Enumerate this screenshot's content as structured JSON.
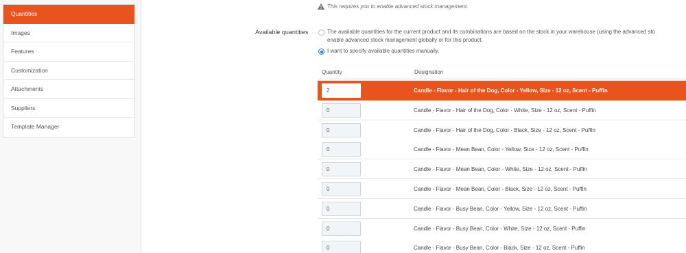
{
  "sidebar": {
    "items": [
      {
        "label": "Quantities",
        "active": true
      },
      {
        "label": "Images",
        "active": false
      },
      {
        "label": "Features",
        "active": false
      },
      {
        "label": "Customization",
        "active": false
      },
      {
        "label": "Attachments",
        "active": false
      },
      {
        "label": "Suppliers",
        "active": false
      },
      {
        "label": "Template Manager",
        "active": false
      }
    ]
  },
  "notice": {
    "icon": "warning-icon",
    "text": "This requires you to enable advanced stock management."
  },
  "available_quantities": {
    "label": "Available quantities",
    "option_1_line1": "The available quantities for the current product and its combinations are based on the stock in your warehouse (using the advanced sto",
    "option_1_line2": "enable advanced stock management globally or for this product.",
    "option_2": "I want to specify available quantities manually."
  },
  "table": {
    "headers": {
      "quantity": "Quantity",
      "designation": "Designation"
    },
    "rows": [
      {
        "quantity": "2",
        "designation": "Candle - Flavor - Hair of the Dog, Color - Yellow, Size - 12 oz, Scent - Puffin",
        "selected": true
      },
      {
        "quantity": "0",
        "designation": "Candle - Flavor - Hair of the Dog, Color - White, Size - 12 oz, Scent - Puffin",
        "selected": false
      },
      {
        "quantity": "0",
        "designation": "Candle - Flavor - Hair of the Dog, Color - Black, Size - 12 oz, Scent - Puffin",
        "selected": false
      },
      {
        "quantity": "0",
        "designation": "Candle - Flavor - Mean Bean, Color - Yellow, Size - 12 oz, Scent - Puffin",
        "selected": false
      },
      {
        "quantity": "0",
        "designation": "Candle - Flavor - Mean Bean, Color - White, Size - 12 oz, Scent - Puffin",
        "selected": false
      },
      {
        "quantity": "0",
        "designation": "Candle - Flavor - Mean Bean, Color - Black, Size - 12 oz, Scent - Puffin",
        "selected": false
      },
      {
        "quantity": "0",
        "designation": "Candle - Flavor - Busy Bean, Color - Yellow, Size - 12 oz, Scent - Puffin",
        "selected": false
      },
      {
        "quantity": "0",
        "designation": "Candle - Flavor - Busy Bean, Color - White, Size - 12 oz, Scent - Puffin",
        "selected": false
      },
      {
        "quantity": "0",
        "designation": "Candle - Flavor - Busy Bean, Color - Black, Size - 12 oz, Scent - Puffin",
        "selected": false
      }
    ]
  },
  "colors": {
    "accent": "#e9531e",
    "radio": "#1a73e8"
  }
}
